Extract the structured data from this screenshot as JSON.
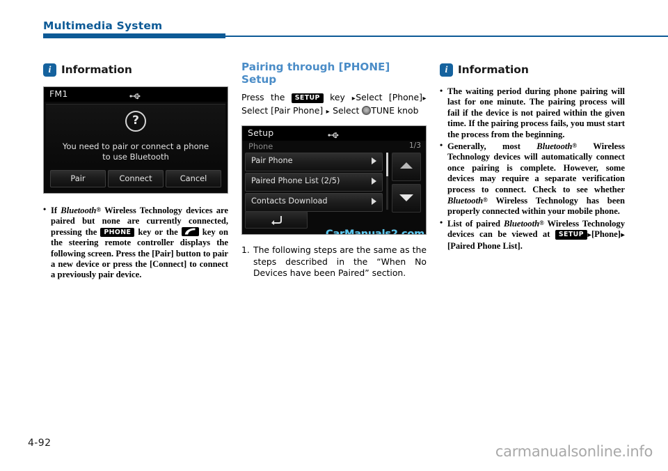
{
  "header": {
    "title": "Multimedia System",
    "accent_color": "#0d5a96"
  },
  "left_column": {
    "info_title": "Information",
    "info_icon": "info-icon",
    "screenshot": {
      "name": "bluetooth-pair-dialog",
      "title": "FM1",
      "usb_icon": "usb-icon",
      "help_icon": "question-mark-icon",
      "message_line1": "You need to pair or connect a phone",
      "message_line2": "to use Bluetooth",
      "buttons": [
        "Pair",
        "Connect",
        "Cancel"
      ]
    },
    "bullets": [
      {
        "segments": [
          {
            "t": "If ",
            "s": "bold"
          },
          {
            "t": "Bluetooth",
            "s": "bold-italic"
          },
          {
            "t": "®",
            "s": "reg"
          },
          {
            "t": " Wireless Technology devices are paired but none are currently connected, pressing the ",
            "s": "bold"
          },
          {
            "t": "PHONE",
            "s": "key-badge"
          },
          {
            "t": " key or the ",
            "s": "bold"
          },
          {
            "t": "phone-handset",
            "s": "key-badge-icon"
          },
          {
            "t": " key on the steering remote controller displays the following screen. Press the [Pair] button to pair a new device or press the [Connect] to connect a previously pair device.",
            "s": "bold"
          }
        ]
      }
    ]
  },
  "middle_column": {
    "section_heading_line1": "Pairing through [PHONE]",
    "section_heading_line2": "Setup",
    "heading_color": "#4a8cc7",
    "instruction": {
      "segments": [
        {
          "t": "Press  the  ",
          "s": "plain"
        },
        {
          "t": "SETUP",
          "s": "key-badge"
        },
        {
          "t": "  key  ",
          "s": "plain"
        },
        {
          "t": "▸",
          "s": "arrow"
        },
        {
          "t": "Select [Phone]",
          "s": "plain"
        },
        {
          "t": "▸",
          "s": "arrow"
        },
        {
          "t": "Select  [Pair  Phone]  ",
          "s": "plain"
        },
        {
          "t": "▸",
          "s": "arrow"
        },
        {
          "t": " Select ",
          "s": "plain"
        },
        {
          "t": "tune-knob",
          "s": "knob"
        },
        {
          "t": "TUNE knob",
          "s": "plain"
        }
      ]
    },
    "screenshot": {
      "name": "setup-phone-menu",
      "title": "Setup",
      "usb_icon": "usb-icon",
      "submenu_label": "Phone",
      "page_indicator": "1/3",
      "rows": [
        {
          "label": "Pair Phone"
        },
        {
          "label": "Paired Phone List (2/5)"
        },
        {
          "label": "Contacts Download"
        }
      ],
      "scroll_up_icon": "triangle-up-icon",
      "scroll_down_icon": "triangle-down-icon",
      "back_icon": "back-arrow-icon",
      "watermark": "CarManuals2.com",
      "watermark_color": "#59c8f0"
    },
    "numbered_items": [
      {
        "number": "1.",
        "text": "The following steps are the same as the steps described in the “When No Devices have been Paired” section."
      }
    ]
  },
  "right_column": {
    "info_title": "Information",
    "info_icon": "info-icon",
    "bullets": [
      {
        "segments": [
          {
            "t": "The waiting period during phone pairing will last for one minute. The pairing process will fail if the device is not paired within the given time. If the pairing process fails, you must start the process from the beginning.",
            "s": "bold"
          }
        ]
      },
      {
        "segments": [
          {
            "t": "Generally,  most  ",
            "s": "bold"
          },
          {
            "t": "Bluetooth",
            "s": "bold-italic"
          },
          {
            "t": "®",
            "s": "reg"
          },
          {
            "t": " Wireless Technology devices will automatically connect once pairing is complete. However, some devices may require a separate verification process to connect. Check to see whether  ",
            "s": "bold"
          },
          {
            "t": "Bluetooth",
            "s": "bold-italic"
          },
          {
            "t": "®",
            "s": "reg"
          },
          {
            "t": "  Wireless Technology has been properly connected within your mobile phone.",
            "s": "bold"
          }
        ]
      },
      {
        "segments": [
          {
            "t": "List of paired ",
            "s": "bold"
          },
          {
            "t": "Bluetooth",
            "s": "bold-italic"
          },
          {
            "t": "®",
            "s": "reg"
          },
          {
            "t": " Wireless Technology devices can be viewed at ",
            "s": "bold"
          },
          {
            "t": "SETUP",
            "s": "key-badge"
          },
          {
            "t": "▸",
            "s": "arrow"
          },
          {
            "t": "[Phone]",
            "s": "bold"
          },
          {
            "t": "▸",
            "s": "arrow"
          },
          {
            "t": "[Paired  Phone List].",
            "s": "bold"
          }
        ]
      }
    ]
  },
  "footer": {
    "page_number": "4-92",
    "site_watermark": "carmanualsonline.info"
  }
}
